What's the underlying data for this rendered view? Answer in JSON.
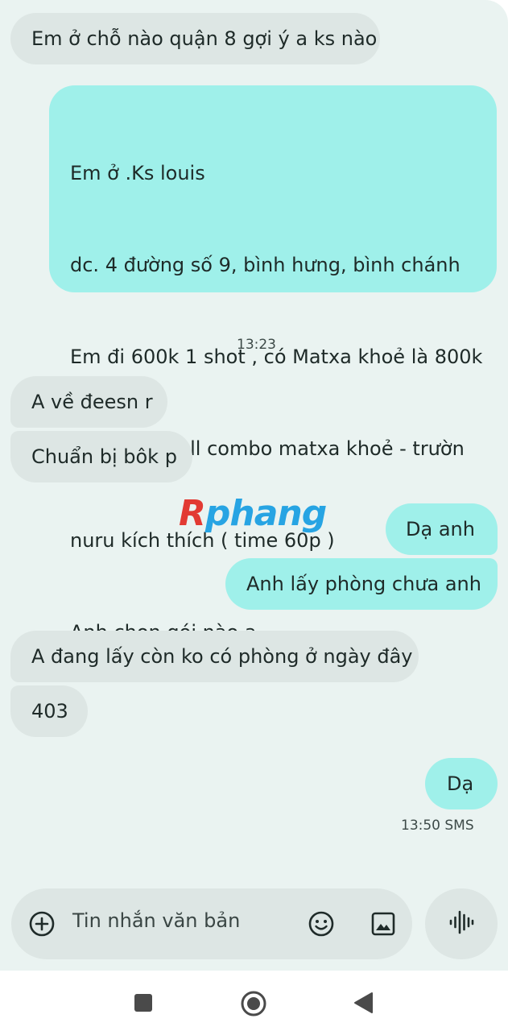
{
  "messages": [
    {
      "id": "m1",
      "dir": "in",
      "text": "Em ở chỗ nào quận 8 gợi ý a ks nào"
    },
    {
      "id": "m2",
      "dir": "out",
      "lines": [
        "Em ở .Ks louis",
        "dc. 4 đường số 9, bình hưng, bình chánh",
        "Em đi 600k 1 shot , có Matxa khoẻ là 800k",
        "Còn 1tr là full combo matxa khoẻ - trườn",
        "nuru kích thích ( time 60p )",
        "Anh chọn gói nào ạ"
      ]
    },
    {
      "id": "m3",
      "dir": "in",
      "text": "A về đeesn r"
    },
    {
      "id": "m4",
      "dir": "in",
      "text": "Chuẩn bị bôk p"
    },
    {
      "id": "m5",
      "dir": "out",
      "text": "Dạ anh"
    },
    {
      "id": "m6",
      "dir": "out",
      "text": "Anh lấy phòng chưa anh"
    },
    {
      "id": "m7",
      "dir": "in",
      "text": "A đang lấy còn ko có phòng ở ngày đây"
    },
    {
      "id": "m8",
      "dir": "in",
      "text": "403"
    },
    {
      "id": "m9",
      "dir": "out",
      "text": "Dạ"
    }
  ],
  "timestamp_1": "13:23",
  "timestamp_2": "13:50 SMS",
  "watermark": {
    "first": "R",
    "rest": "phang"
  },
  "composer": {
    "placeholder": "Tin nhắn văn bản",
    "icons": [
      "add-icon",
      "emoji-icon",
      "image-icon",
      "voice-icon"
    ]
  },
  "navbar": {
    "icons": [
      "recents-icon",
      "home-icon",
      "back-icon"
    ]
  },
  "colors": {
    "incoming": "#dde6e4",
    "outgoing": "#9ff0ea",
    "background": "#eaf3f1"
  }
}
